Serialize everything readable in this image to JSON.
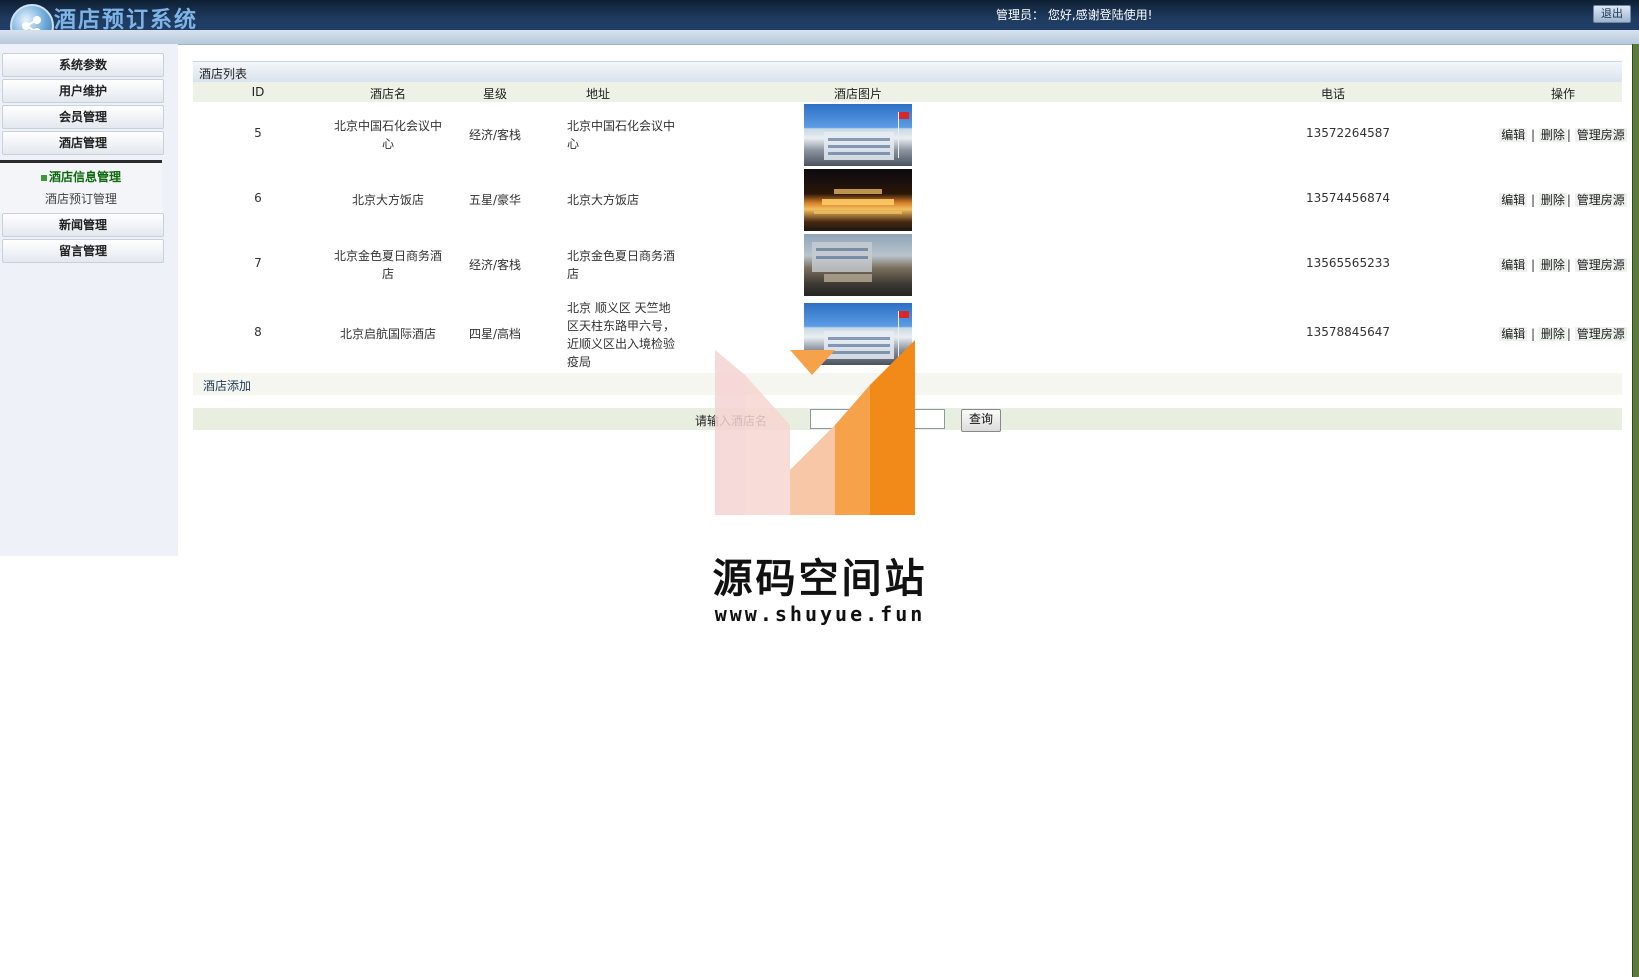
{
  "header": {
    "app_title": "酒店预订系统",
    "greeting": "管理员：  您好,感谢登陆使用!",
    "logout_label": "退出"
  },
  "sidebar": {
    "items": [
      {
        "label": "系统参数"
      },
      {
        "label": "用户维护"
      },
      {
        "label": "会员管理"
      },
      {
        "label": "酒店管理"
      }
    ],
    "sub_items": [
      {
        "label": "酒店信息管理",
        "active": true
      },
      {
        "label": "酒店预订管理",
        "active": false
      }
    ],
    "items_after": [
      {
        "label": "新闻管理"
      },
      {
        "label": "留言管理"
      }
    ]
  },
  "main": {
    "section_title": "酒店列表",
    "columns": [
      "ID",
      "酒店名",
      "星级",
      "地址",
      "酒店图片",
      "电话",
      "操作"
    ],
    "rows": [
      {
        "id": "5",
        "name": "北京中国石化会议中心",
        "star": "经济/客栈",
        "address": "北京中国石化会议中心",
        "phone": "13572264587",
        "image": "hotel-blue-building"
      },
      {
        "id": "6",
        "name": "北京大方饭店",
        "star": "五星/豪华",
        "address": "北京大方饭店",
        "phone": "13574456874",
        "image": "hotel-night"
      },
      {
        "id": "7",
        "name": "北京金色夏日商务酒店",
        "star": "经济/客栈",
        "address": "北京金色夏日商务酒店",
        "phone": "13565565233",
        "image": "hotel-entrance"
      },
      {
        "id": "8",
        "name": "北京启航国际酒店",
        "star": "四星/高档",
        "address": "北京 顺义区 天竺地区天柱东路甲六号，近顺义区出入境检验疫局",
        "phone": "13578845647",
        "image": "hotel-blue-building"
      }
    ],
    "ops": {
      "edit": "编辑",
      "delete": "删除",
      "rooms": "管理房源",
      "sep": "|"
    },
    "add_label": "酒店添加",
    "search": {
      "label": "请输入酒店名",
      "value": "",
      "button": "查询"
    }
  },
  "watermark": {
    "title": "源码空间站",
    "url": "www.shuyue.fun",
    "colors": [
      "#f4d2d2",
      "#f7c7a7",
      "#f6a24a",
      "#f28a1a"
    ]
  }
}
